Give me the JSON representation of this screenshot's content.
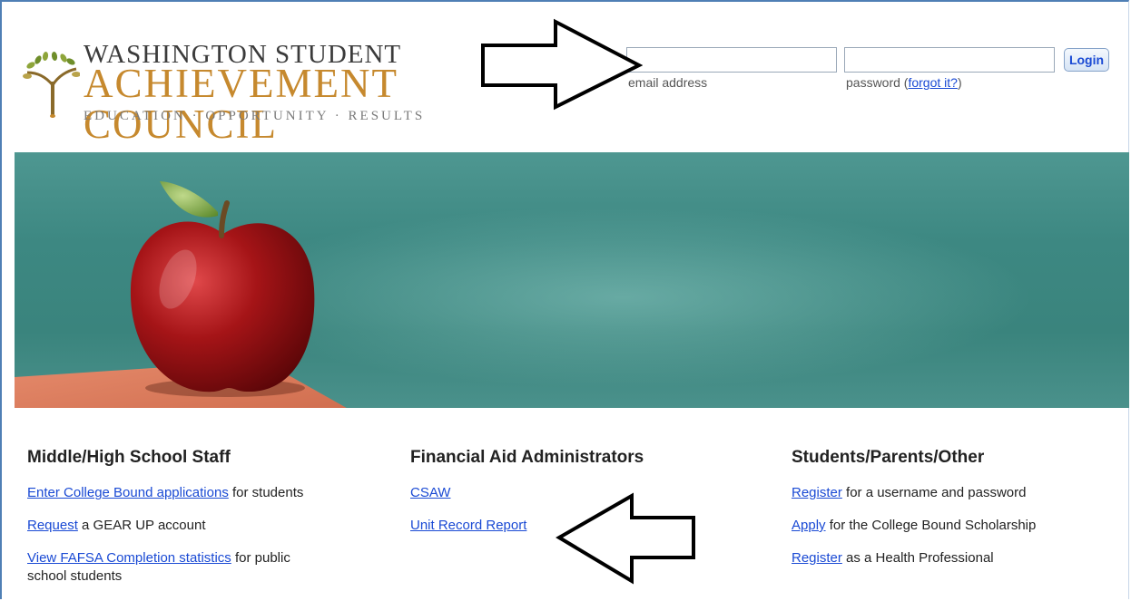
{
  "header": {
    "logo_line1": "WASHINGTON STUDENT",
    "logo_line2": "ACHIEVEMENT COUNCIL",
    "logo_line3": "EDUCATION · OPPORTUNITY · RESULTS"
  },
  "login": {
    "email_value": "",
    "email_label": "email address",
    "password_value": "",
    "password_label_prefix": "password (",
    "forgot_link": "forgot it?",
    "password_label_suffix": ")",
    "button_label": "Login"
  },
  "columns": [
    {
      "heading": "Middle/High School Staff",
      "items": [
        {
          "link": "Enter College Bound applications",
          "text": " for students"
        },
        {
          "link": "Request",
          "text": " a GEAR UP account"
        },
        {
          "link": "View FAFSA Completion statistics",
          "text": " for public school students"
        }
      ]
    },
    {
      "heading": "Financial Aid Administrators",
      "items": [
        {
          "link": "CSAW",
          "text": ""
        },
        {
          "link": "Unit Record Report",
          "text": ""
        }
      ]
    },
    {
      "heading": "Students/Parents/Other",
      "items": [
        {
          "link": "Register",
          "text": " for a username and password"
        },
        {
          "link": "Apply",
          "text": " for the College Bound Scholarship"
        },
        {
          "link": "Register",
          "text": " as a Health Professional"
        }
      ]
    }
  ],
  "colors": {
    "link": "#1a4ad4",
    "logo_gold": "#c6892e",
    "chalkboard": "#3d8882"
  },
  "icons": {
    "logo": "sprouting-plant-icon",
    "annotation_arrow_top": "arrow-right-outline-icon",
    "annotation_arrow_bottom": "arrow-left-outline-icon"
  }
}
